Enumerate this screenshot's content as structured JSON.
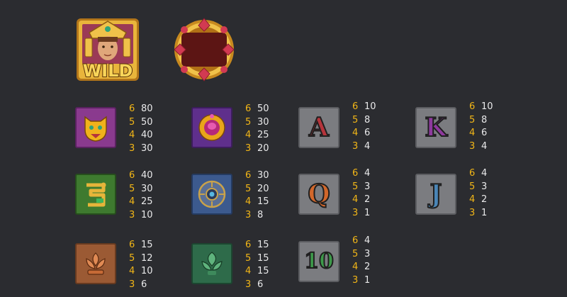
{
  "special_symbols": {
    "wild": {
      "name": "wild-symbol",
      "text": "WILD"
    },
    "scatter": {
      "name": "scatter-frame-symbol"
    }
  },
  "paytable": [
    {
      "symbol": "jaguar",
      "icon": "jaguar-mask-icon",
      "colors": {
        "bg": "#8a3a8e",
        "fg": "#f0b21c"
      },
      "pays": [
        [
          "6",
          "80"
        ],
        [
          "5",
          "50"
        ],
        [
          "4",
          "40"
        ],
        [
          "3",
          "30"
        ]
      ]
    },
    {
      "symbol": "amulet",
      "icon": "jeweled-amulet-icon",
      "colors": {
        "bg": "#5f2f8c",
        "fg": "#e9a51a"
      },
      "pays": [
        [
          "6",
          "50"
        ],
        [
          "5",
          "30"
        ],
        [
          "4",
          "25"
        ],
        [
          "3",
          "20"
        ]
      ]
    },
    {
      "symbol": "A",
      "text": "A",
      "colors": {
        "bg": "#7b7c80",
        "fg": "#b5343b"
      },
      "pays": [
        [
          "6",
          "10"
        ],
        [
          "5",
          "8"
        ],
        [
          "4",
          "6"
        ],
        [
          "3",
          "4"
        ]
      ]
    },
    {
      "symbol": "K",
      "text": "K",
      "colors": {
        "bg": "#7b7c80",
        "fg": "#8f3a9e"
      },
      "pays": [
        [
          "6",
          "10"
        ],
        [
          "5",
          "8"
        ],
        [
          "4",
          "6"
        ],
        [
          "3",
          "4"
        ]
      ]
    },
    {
      "symbol": "serpent",
      "icon": "serpent-icon",
      "colors": {
        "bg": "#3e7a2f",
        "fg": "#e7b53a"
      },
      "pays": [
        [
          "6",
          "40"
        ],
        [
          "5",
          "30"
        ],
        [
          "4",
          "25"
        ],
        [
          "3",
          "10"
        ]
      ]
    },
    {
      "symbol": "calendar-stone",
      "icon": "calendar-stone-icon",
      "colors": {
        "bg": "#3c5a8e",
        "fg": "#c9a24a"
      },
      "pays": [
        [
          "6",
          "30"
        ],
        [
          "5",
          "20"
        ],
        [
          "4",
          "15"
        ],
        [
          "3",
          "8"
        ]
      ]
    },
    {
      "symbol": "Q",
      "text": "Q",
      "colors": {
        "bg": "#7b7c80",
        "fg": "#d2672b"
      },
      "pays": [
        [
          "6",
          "4"
        ],
        [
          "5",
          "3"
        ],
        [
          "4",
          "2"
        ],
        [
          "3",
          "1"
        ]
      ]
    },
    {
      "symbol": "J",
      "text": "J",
      "colors": {
        "bg": "#7b7c80",
        "fg": "#4a86b7"
      },
      "pays": [
        [
          "6",
          "4"
        ],
        [
          "5",
          "3"
        ],
        [
          "4",
          "2"
        ],
        [
          "3",
          "1"
        ]
      ]
    },
    {
      "symbol": "lotus",
      "icon": "lotus-ornament-icon",
      "colors": {
        "bg": "#9b5a34",
        "fg": "#e08a54"
      },
      "pays": [
        [
          "6",
          "15"
        ],
        [
          "5",
          "12"
        ],
        [
          "4",
          "10"
        ],
        [
          "3",
          "6"
        ]
      ]
    },
    {
      "symbol": "leaf",
      "icon": "leaf-ornament-icon",
      "colors": {
        "bg": "#2e6b4a",
        "fg": "#5fb37d"
      },
      "pays": [
        [
          "6",
          "15"
        ],
        [
          "5",
          "15"
        ],
        [
          "4",
          "15"
        ],
        [
          "3",
          "6"
        ]
      ]
    },
    {
      "symbol": "10",
      "text": "10",
      "colors": {
        "bg": "#7b7c80",
        "fg": "#3d9a4a"
      },
      "pays": [
        [
          "6",
          "4"
        ],
        [
          "5",
          "3"
        ],
        [
          "4",
          "2"
        ],
        [
          "3",
          "1"
        ]
      ]
    }
  ]
}
